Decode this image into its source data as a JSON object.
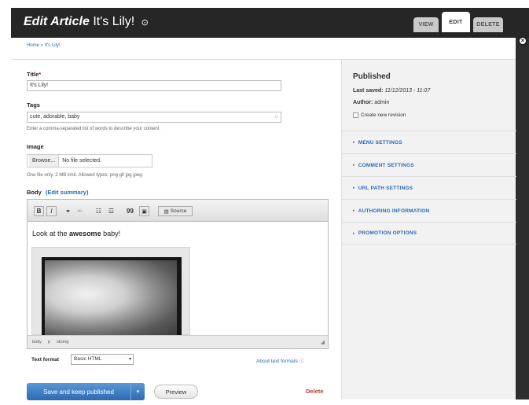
{
  "header": {
    "title_prefix": "Edit Article",
    "title_article": "It's Lily!",
    "title_icon": "⊙",
    "tabs": [
      "VIEW",
      "EDIT",
      "DELETE"
    ]
  },
  "breadcrumb": "Home » It's Lily!",
  "form": {
    "title_label": "Title",
    "required_mark": "*",
    "title_value": "It's Lily!",
    "tags_label": "Tags",
    "tags_value": "cute, adorable, baby",
    "tags_desc": "Enter a comma-separated list of words to describe your content.",
    "image_label": "Image",
    "browse_label": "Browse...",
    "no_file": "No file selected.",
    "image_desc": "One file only. 2 MB limit. Allowed types: png gif jpg jpeg.",
    "body_label": "Body",
    "edit_summary": "(Edit summary)",
    "toolbar": {
      "bold": "B",
      "italic": "I",
      "bullet_list": "☷",
      "numbered_list": "☲",
      "quote": "99",
      "source": "Source"
    },
    "body_text_pre": "Look at the ",
    "body_text_bold": "awesome",
    "body_text_post": " baby!",
    "path": [
      "body",
      "p",
      "strong"
    ],
    "text_format_label": "Text format",
    "text_format_value": "Basic HTML",
    "about_formats": "About text formats",
    "save_label": "Save and keep published",
    "preview_label": "Preview",
    "delete_label": "Delete"
  },
  "sidebar": {
    "status": "Published",
    "last_saved_label": "Last saved:",
    "last_saved_value": "11/12/2013 - 11:07",
    "author_label": "Author:",
    "author_value": "admin",
    "revision_label": "Create new revision",
    "sections": [
      "MENU SETTINGS",
      "COMMENT SETTINGS",
      "URL PATH SETTINGS",
      "AUTHORING INFORMATION",
      "PROMOTION OPTIONS"
    ]
  },
  "colors": {
    "accent": "#2a6ab5",
    "primary_button": "#3a7cc4",
    "danger": "#c0392b",
    "header_bg": "#262626"
  }
}
